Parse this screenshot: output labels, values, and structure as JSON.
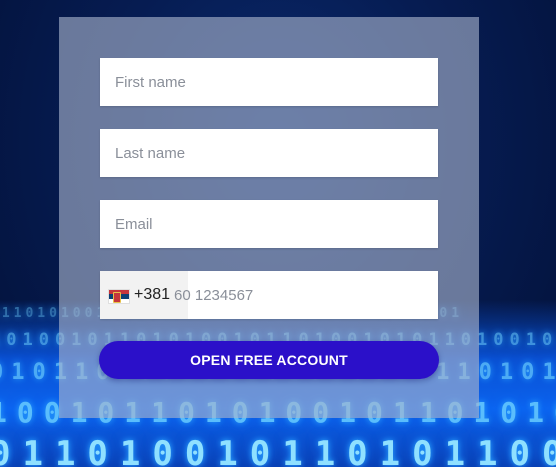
{
  "form": {
    "first_name_placeholder": "First name",
    "last_name_placeholder": "Last name",
    "email_placeholder": "Email",
    "phone": {
      "country_flag_icon": "serbia-flag-icon",
      "dial_code": "+381",
      "placeholder": "60 1234567"
    },
    "submit_label": "OPEN FREE ACCOUNT"
  },
  "background": {
    "binary_rows": [
      "0110101001011010100101101011010010101101",
      "10100101101010010110100101011010010110",
      "0101101001011010100101101010010",
      "10010110101001011010100101",
      "0110100101101011001011"
    ]
  },
  "colors": {
    "button_bg": "#2b10c9",
    "panel_bg": "rgba(170,180,205,0.62)",
    "background": "#04163f"
  }
}
